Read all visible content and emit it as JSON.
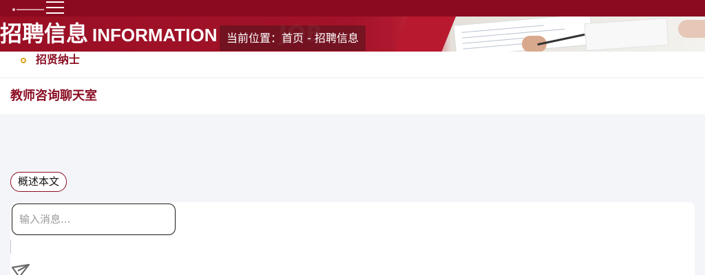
{
  "header": {
    "logo_name": "school-logo",
    "menu_icon": "hamburger-menu-icon",
    "colors": {
      "primary": "#8c0a1f",
      "accent": "#d8a21b"
    }
  },
  "banner": {
    "title_cn": "招聘信息",
    "title_en": "INFORMATION",
    "location_label": "当前位置：",
    "location_home": "首页",
    "location_sep": " - ",
    "location_current": "招聘信息"
  },
  "nav": {
    "item": "招贤纳士"
  },
  "chat": {
    "title": "教师咨询聊天室",
    "summary_button": "概述本文",
    "input_placeholder": "输入消息...",
    "input_value": "",
    "send_icon": "send-paper-plane-icon"
  }
}
